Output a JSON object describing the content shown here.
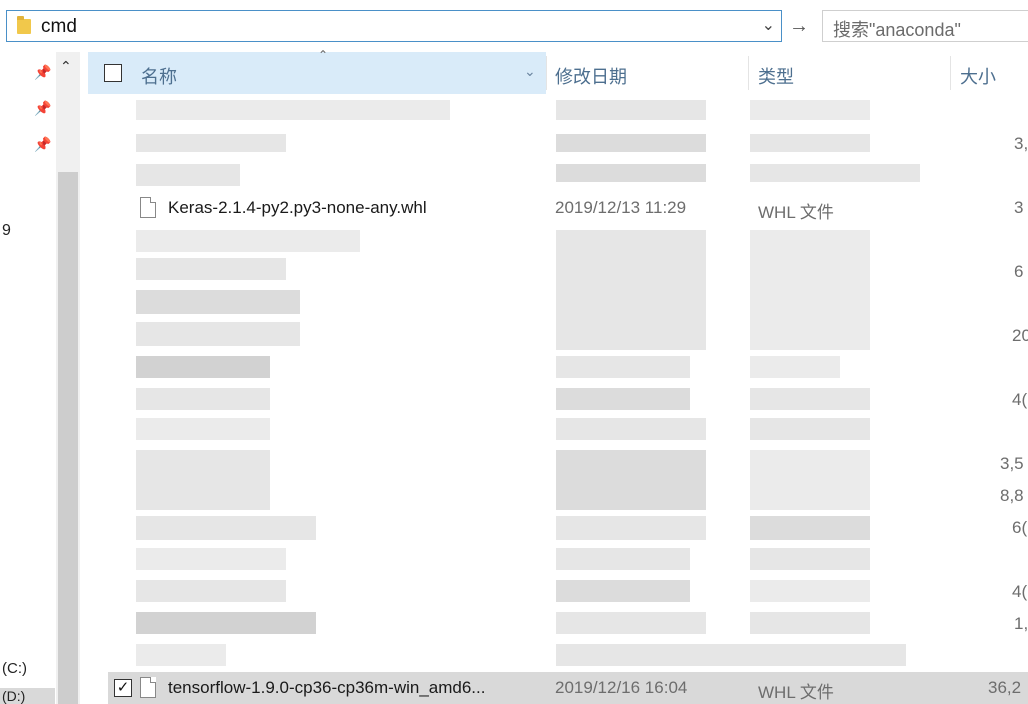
{
  "address_bar": {
    "path": "cmd",
    "dropdown_icon": "chevron-down-icon"
  },
  "go_icon": "arrow-right-icon",
  "search": {
    "placeholder": "搜索\"anaconda\""
  },
  "nav": {
    "label_9": "9",
    "drive_c": "(C:)",
    "drive_d": "(D:)"
  },
  "header": {
    "name": "名称",
    "date": "修改日期",
    "type": "类型",
    "size": "大小"
  },
  "files": [
    {
      "name": "Keras-2.1.4-py2.py3-none-any.whl",
      "date": "2019/12/13 11:29",
      "type": "WHL 文件",
      "size": "3"
    },
    {
      "name": "tensorflow-1.9.0-cp36-cp36m-win_amd6...",
      "date": "2019/12/16 16:04",
      "type": "WHL 文件",
      "size": "36,2"
    }
  ],
  "size_fragments": [
    "3,",
    "6",
    "20",
    "4(",
    "3,5",
    "8,8",
    "6(",
    "4(",
    "1,"
  ]
}
